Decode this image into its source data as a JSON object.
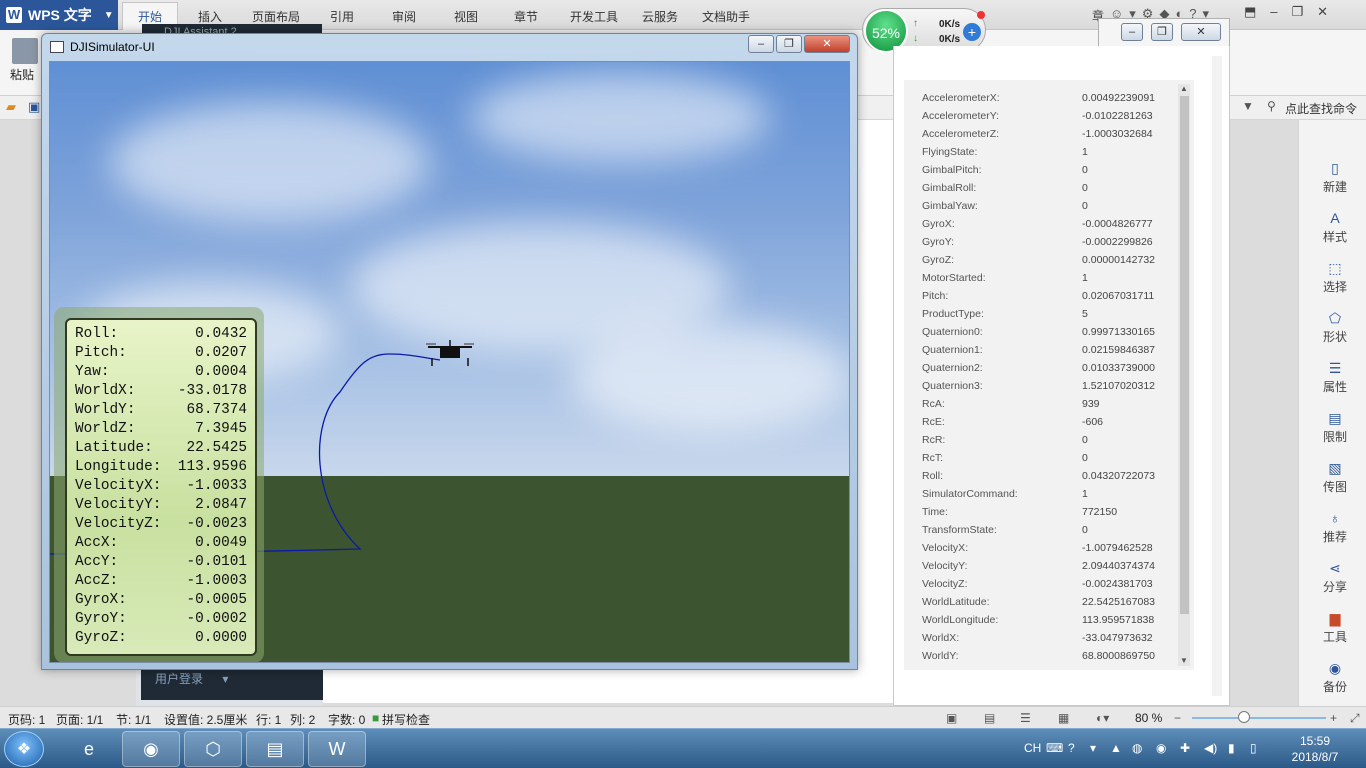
{
  "wps": {
    "app_name": "WPS 文字",
    "tabs": [
      "开始",
      "插入",
      "页面布局",
      "引用",
      "审阅",
      "视图",
      "章节",
      "开发工具",
      "云服务",
      "文档助手"
    ],
    "paste_label": "粘贴",
    "search_command": "点此查找命令",
    "bg_doc_title": "DJI Assistant 2",
    "right_tools": [
      "新建",
      "样式",
      "选择",
      "形状",
      "属性",
      "限制",
      "传图",
      "推荐",
      "分享",
      "工具",
      "备份"
    ],
    "login_label": "用户登录",
    "status": {
      "page_no": "页码: 1",
      "page": "页面: 1/1",
      "section": "节: 1/1",
      "setting": "设置值: 2.5厘米",
      "row": "行: 1",
      "col": "列: 2",
      "words": "字数: 0",
      "spell": "拼写检查",
      "zoom": "80 %"
    }
  },
  "net_widget": {
    "percent": "52%",
    "up": "0K/s",
    "down": "0K/s"
  },
  "simulator": {
    "title": "DJISimulator-UI",
    "hud": [
      {
        "label": "Roll:",
        "value": "0.0432"
      },
      {
        "label": "Pitch:",
        "value": "0.0207"
      },
      {
        "label": "Yaw:",
        "value": "0.0004"
      },
      {
        "label": "WorldX:",
        "value": "-33.0178"
      },
      {
        "label": "WorldY:",
        "value": "68.7374"
      },
      {
        "label": "WorldZ:",
        "value": "7.3945"
      },
      {
        "label": "Latitude:",
        "value": "22.5425"
      },
      {
        "label": "Longitude:",
        "value": "113.9596"
      },
      {
        "label": "VelocityX:",
        "value": "-1.0033"
      },
      {
        "label": "VelocityY:",
        "value": "2.0847"
      },
      {
        "label": "VelocityZ:",
        "value": "-0.0023"
      },
      {
        "label": "AccX:",
        "value": "0.0049"
      },
      {
        "label": "AccY:",
        "value": "-0.0101"
      },
      {
        "label": "AccZ:",
        "value": "-1.0003"
      },
      {
        "label": "GyroX:",
        "value": "-0.0005"
      },
      {
        "label": "GyroY:",
        "value": "-0.0002"
      },
      {
        "label": "GyroZ:",
        "value": "0.0000"
      }
    ]
  },
  "data_panel": [
    {
      "key": "AccelerometerX:",
      "value": "0.00492239091"
    },
    {
      "key": "AccelerometerY:",
      "value": "-0.0102281263"
    },
    {
      "key": "AccelerometerZ:",
      "value": "-1.0003032684"
    },
    {
      "key": "FlyingState:",
      "value": "1"
    },
    {
      "key": "GimbalPitch:",
      "value": "0"
    },
    {
      "key": "GimbalRoll:",
      "value": "0"
    },
    {
      "key": "GimbalYaw:",
      "value": "0"
    },
    {
      "key": "GyroX:",
      "value": "-0.0004826777"
    },
    {
      "key": "GyroY:",
      "value": "-0.0002299826"
    },
    {
      "key": "GyroZ:",
      "value": "0.00000142732"
    },
    {
      "key": "MotorStarted:",
      "value": "1"
    },
    {
      "key": "Pitch:",
      "value": "0.02067031711"
    },
    {
      "key": "ProductType:",
      "value": "5"
    },
    {
      "key": "Quaternion0:",
      "value": "0.99971330165"
    },
    {
      "key": "Quaternion1:",
      "value": "0.02159846387"
    },
    {
      "key": "Quaternion2:",
      "value": "0.01033739000"
    },
    {
      "key": "Quaternion3:",
      "value": "1.52107020312"
    },
    {
      "key": "RcA:",
      "value": "939"
    },
    {
      "key": "RcE:",
      "value": "-606"
    },
    {
      "key": "RcR:",
      "value": "0"
    },
    {
      "key": "RcT:",
      "value": "0"
    },
    {
      "key": "Roll:",
      "value": "0.04320722073"
    },
    {
      "key": "SimulatorCommand:",
      "value": "1"
    },
    {
      "key": "Time:",
      "value": "772150"
    },
    {
      "key": "TransformState:",
      "value": "0"
    },
    {
      "key": "VelocityX:",
      "value": "-1.0079462528"
    },
    {
      "key": "VelocityY:",
      "value": "2.09440374374"
    },
    {
      "key": "VelocityZ:",
      "value": "-0.0024381703"
    },
    {
      "key": "WorldLatitude:",
      "value": "22.5425167083"
    },
    {
      "key": "WorldLongitude:",
      "value": "113.959571838"
    },
    {
      "key": "WorldX:",
      "value": "-33.047973632"
    },
    {
      "key": "WorldY:",
      "value": "68.8000869750"
    }
  ],
  "taskbar": {
    "time": "15:59",
    "date": "2018/8/7",
    "lang": "CH"
  },
  "colors": {
    "accent": "#2b579a",
    "ground": "#3d5430",
    "track": "#0a1aa8",
    "hud_bg": "#d8eab8"
  }
}
